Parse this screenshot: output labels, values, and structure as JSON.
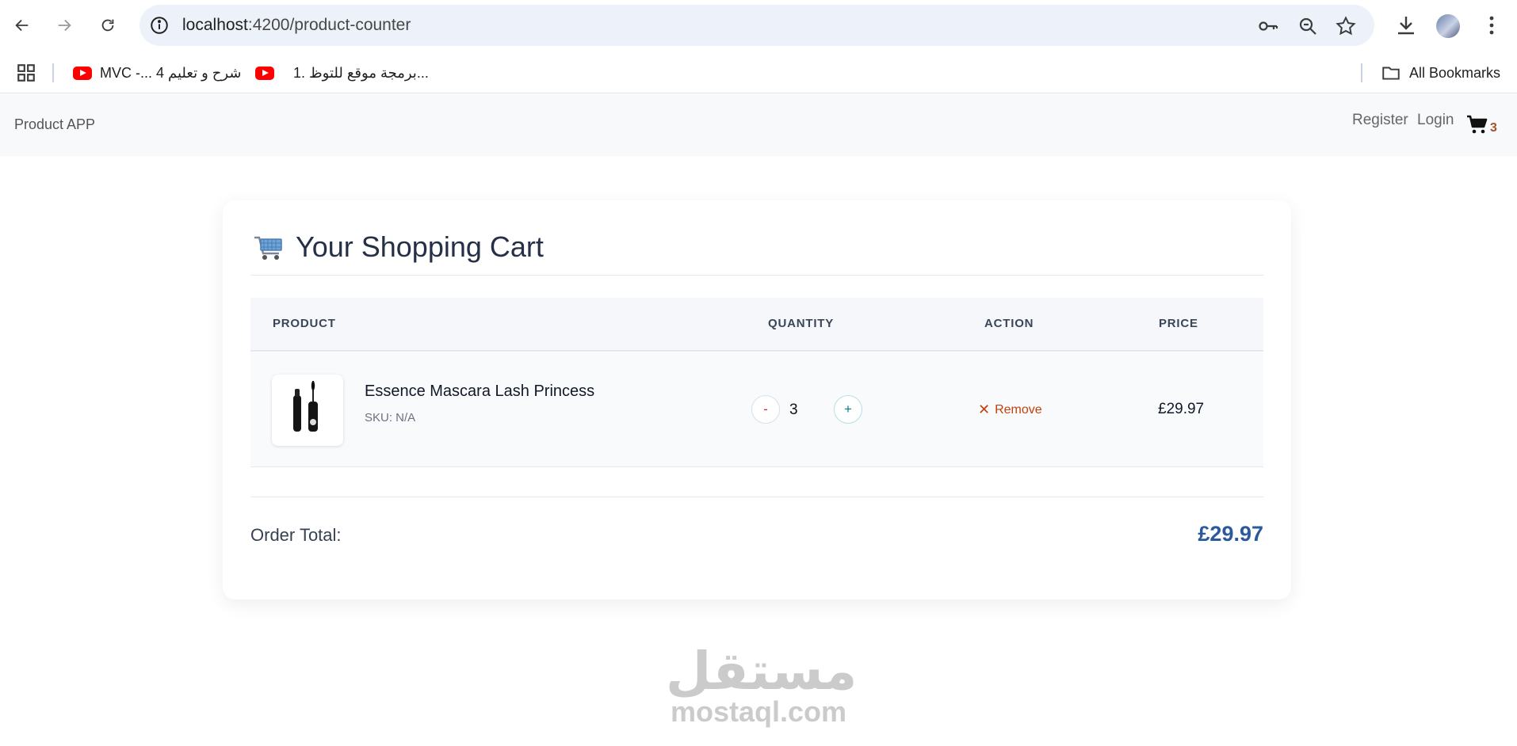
{
  "browser": {
    "url_host": "localhost",
    "url_path": ":4200/product-counter",
    "icons": [
      "back-arrow-icon",
      "forward-arrow-icon",
      "reload-icon",
      "site-info-icon",
      "password-key-icon",
      "zoom-icon",
      "bookmark-star-icon",
      "download-icon",
      "profile-avatar",
      "more-menu-icon"
    ]
  },
  "bookmarks_bar": {
    "items": [
      {
        "label": "MVC -... شرح و تعليم 4",
        "icon": "youtube-icon"
      },
      {
        "label": "1. برمجة موقع للتوظ...",
        "icon": "youtube-icon"
      }
    ],
    "all_bookmarks_label": "All Bookmarks"
  },
  "app_nav": {
    "brand": "Product APP",
    "register": "Register",
    "login": "Login",
    "cart_count": "3"
  },
  "cart": {
    "title": "Your Shopping Cart",
    "columns": {
      "product": "PRODUCT",
      "quantity": "QUANTITY",
      "action": "ACTION",
      "price": "PRICE"
    },
    "items": [
      {
        "name": "Essence Mascara Lash Princess",
        "sku": "SKU: N/A",
        "minus": "-",
        "quantity": "3",
        "plus": "+",
        "remove_label": "Remove",
        "remove_symbol": "✕",
        "price": "£29.97"
      }
    ],
    "total_label": "Order Total:",
    "total_value": "£29.97"
  },
  "watermark": {
    "arabic": "مستقل",
    "latin": "mostaql.com"
  },
  "colors": {
    "accent_total": "#2b5a9c",
    "remove": "#c2410c",
    "cart_badge": "#a0522d"
  }
}
